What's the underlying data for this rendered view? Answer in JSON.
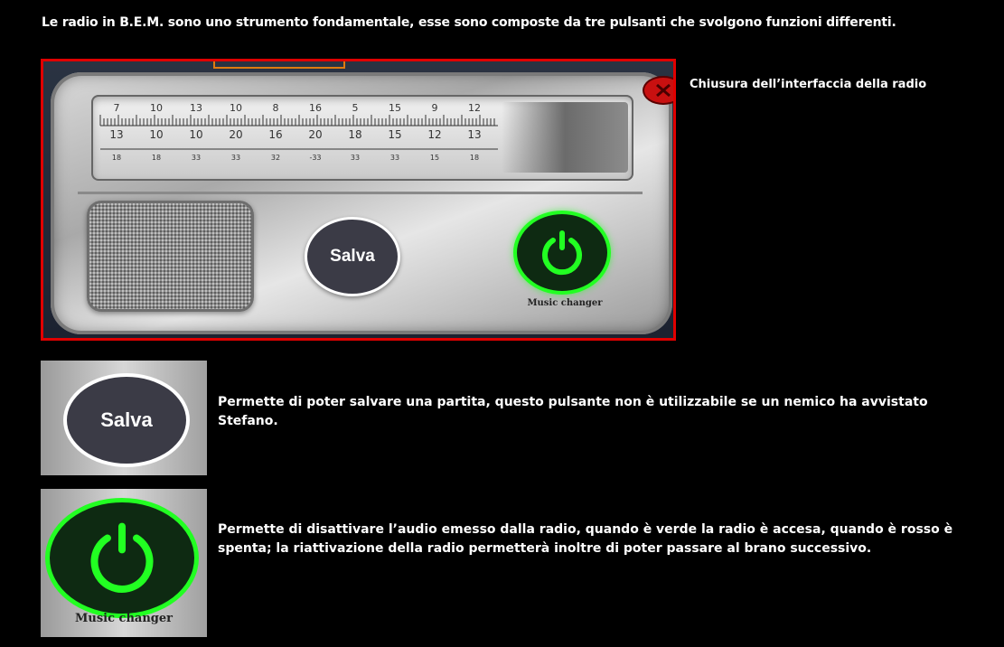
{
  "intro": "Le radio in B.E.M. sono uno strumento fondamentale, esse sono composte da tre pulsanti che svolgono funzioni differenti.",
  "radio": {
    "dial_top": [
      "7",
      "10",
      "13",
      "10",
      "8",
      "16",
      "5",
      "15",
      "9",
      "12"
    ],
    "dial_mid": [
      "13",
      "10",
      "10",
      "20",
      "16",
      "20",
      "18",
      "15",
      "12",
      "13"
    ],
    "dial_low": [
      "18",
      "18",
      "33",
      "33",
      "32",
      "-33",
      "33",
      "33",
      "15",
      "18"
    ],
    "save_label": "Salva",
    "music_label": "Music changer",
    "close_icon": "close-icon",
    "power_icon": "power-icon"
  },
  "captions": {
    "close": "Chiusura dell’interfaccia della radio",
    "salva": "Permette di poter salvare una partita, questo pulsante non è utilizzabile se un nemico ha avvistato Stefano.",
    "power": "Permette di disattivare l’audio emesso dalla radio, quando è verde la radio è accesa, quando è rosso è spenta; la riattivazione della radio permetterà inoltre di poter passare al brano successivo."
  },
  "thumbs": {
    "salva_label": "Salva",
    "music_label": "Music changer"
  },
  "colors": {
    "highlight_border": "#e00000",
    "power_green": "#22ff22",
    "save_button": "#3b3b46",
    "close_red": "#c81010"
  }
}
